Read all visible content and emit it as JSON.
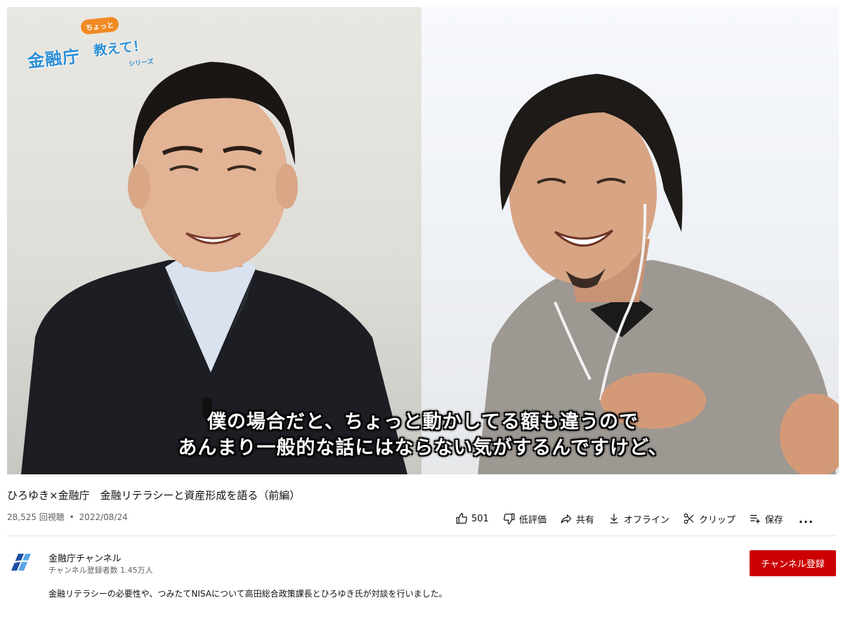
{
  "video": {
    "logo": {
      "kicker": "ちょっと",
      "main": "金融庁",
      "sub": "教えて！",
      "series": "シリーズ"
    },
    "subtitle_line1": "僕の場合だと、ちょっと動かしてる額も違うので",
    "subtitle_line2": "あんまり一般的な話にはならない気がするんですけど、"
  },
  "title": "ひろゆき×金融庁　金融リテラシーと資産形成を語る（前編）",
  "meta": {
    "views": "28,525 回視聴",
    "separator": "•",
    "date": "2022/08/24"
  },
  "actions": {
    "like_count": "501",
    "dislike_label": "低評価",
    "share_label": "共有",
    "offline_label": "オフライン",
    "clip_label": "クリップ",
    "save_label": "保存",
    "more_label": "..."
  },
  "channel": {
    "name": "金融庁チャンネル",
    "subscribers": "チャンネル登録者数 1.45万人",
    "subscribe_label": "チャンネル登録"
  },
  "description": "金融リテラシーの必要性や、つみたてNISAについて高田総合政策課長とひろゆき氏が対談を行いました。",
  "colors": {
    "subscribe_bg": "#cc0000",
    "logo_blue": "#2b8fd6",
    "logo_orange": "#f08a24"
  },
  "icons": [
    "thumbs-up-icon",
    "thumbs-down-icon",
    "share-icon",
    "download-icon",
    "scissors-icon",
    "playlist-add-icon",
    "more-icon"
  ]
}
